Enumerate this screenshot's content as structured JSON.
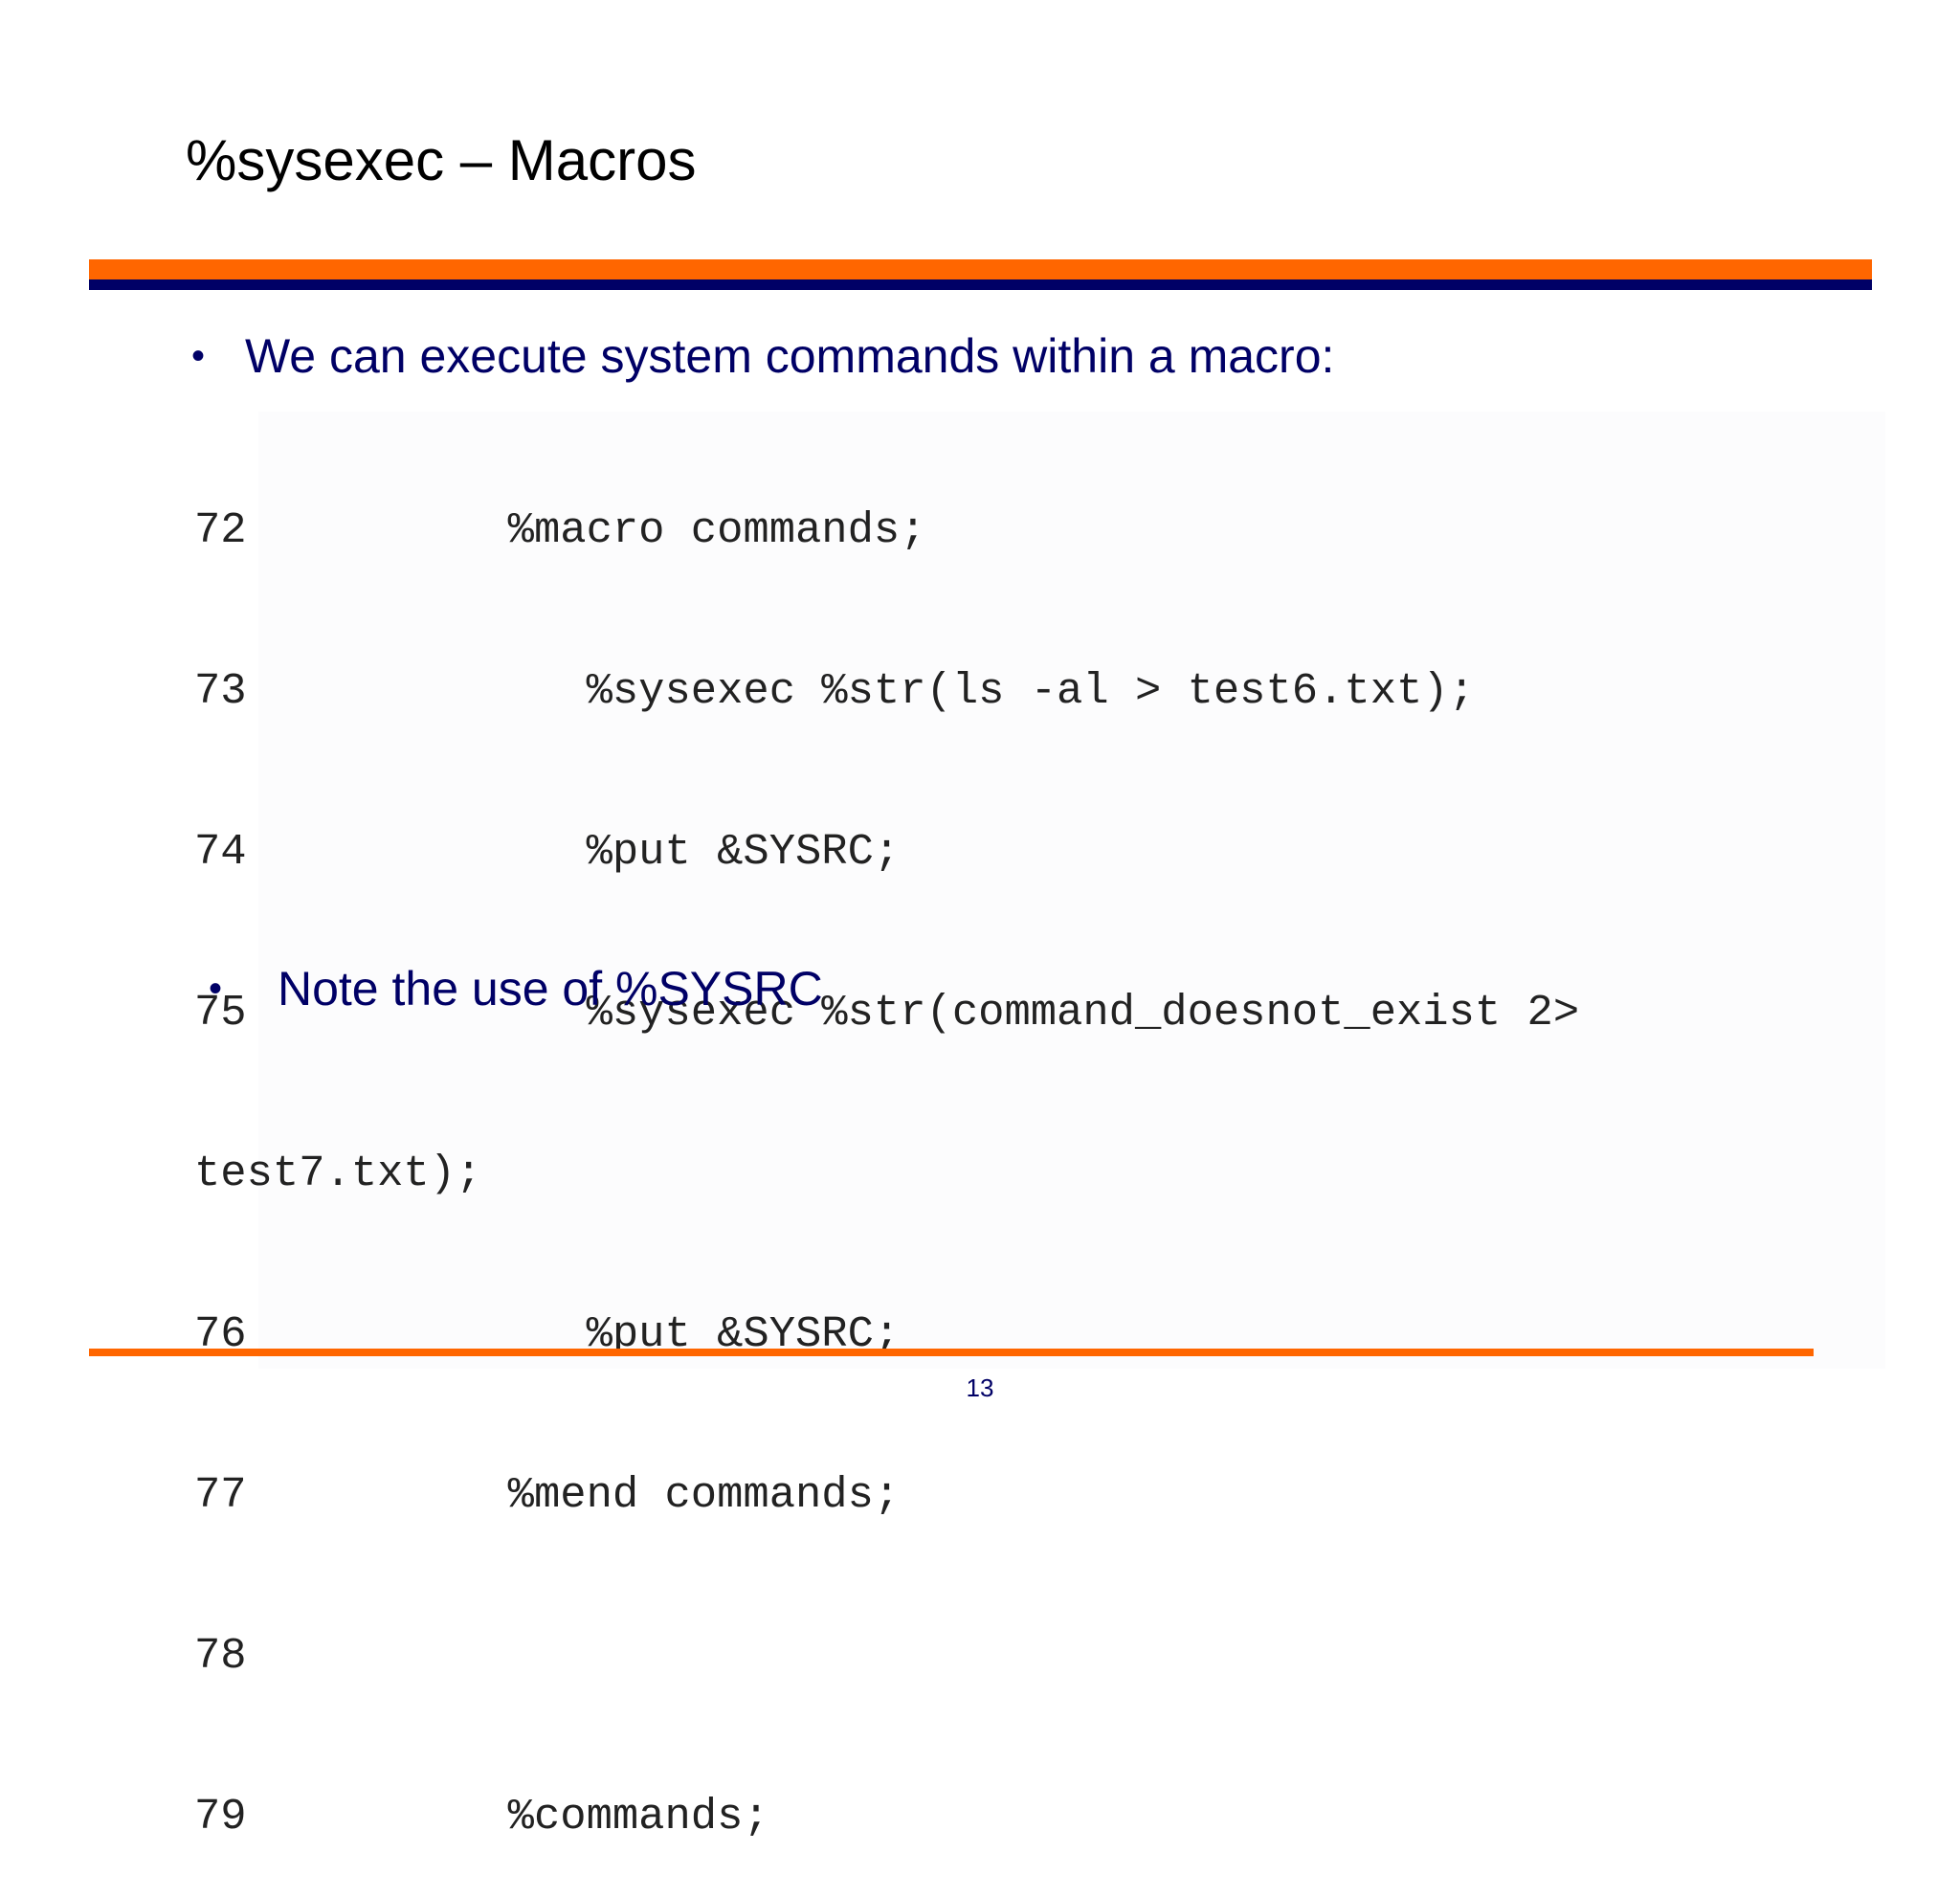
{
  "slide": {
    "title": "%sysexec – Macros",
    "bullet_1": "We can execute system commands within a macro:",
    "bullet_symbol": "•",
    "code_lines": [
      "72          %macro commands;",
      "73             %sysexec %str(ls -al > test6.txt);",
      "74             %put &SYSRC;",
      "75             %sysexec %str(command_doesnot_exist 2>",
      "test7.txt);",
      "76             %put &SYSRC;",
      "77          %mend commands;",
      "78",
      "79          %commands;"
    ],
    "bullet_2": "Note the use of %SYSRC",
    "page_number": "13"
  },
  "colors": {
    "accent_orange": "#ff6600",
    "navy": "#000066"
  }
}
